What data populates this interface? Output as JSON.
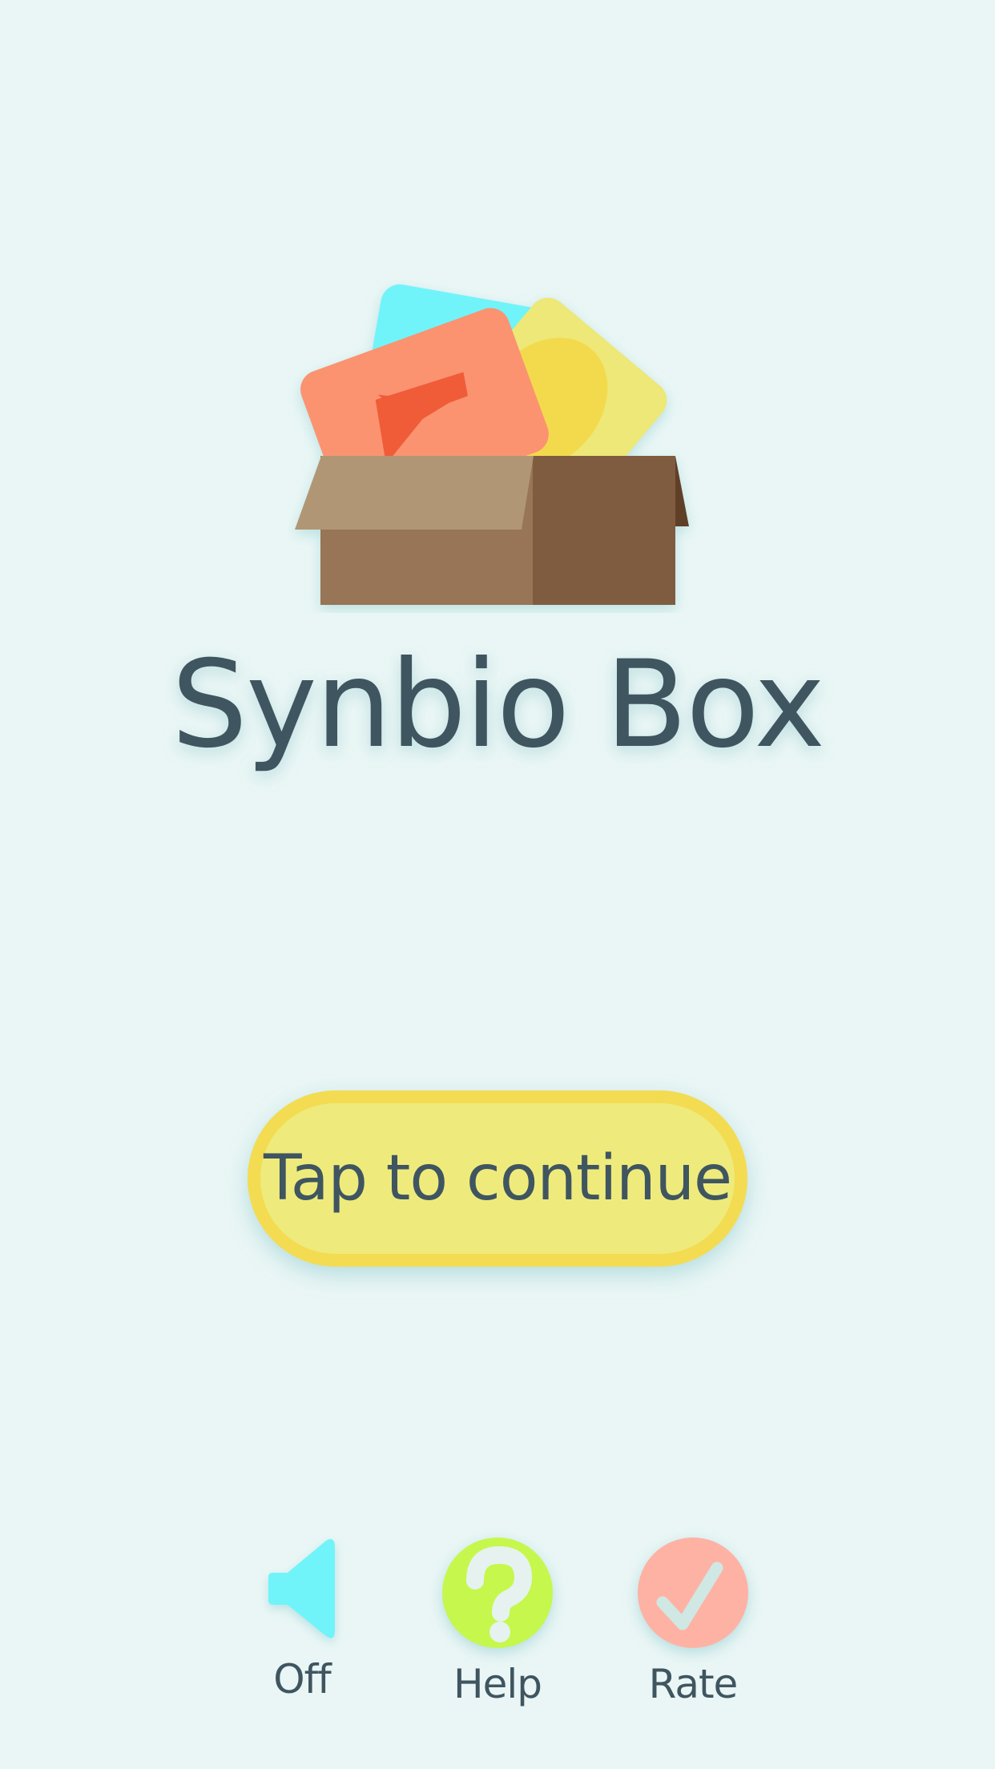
{
  "app": {
    "title": "Synbio Box"
  },
  "main": {
    "continue_label": "Tap to continue"
  },
  "bottom_bar": {
    "sound": {
      "label": "Off",
      "icon": "speaker-icon"
    },
    "help": {
      "label": "Help",
      "icon": "question-mark-icon"
    },
    "rate": {
      "label": "Rate",
      "icon": "checkmark-icon"
    }
  },
  "colors": {
    "background": "#e9f6f5",
    "text": "#3f5560",
    "button_fill": "#eeeb7c",
    "button_border": "#f3dc52",
    "sound_icon": "#6ff4fa",
    "help_circle": "#c6f74d",
    "rate_circle": "#feb2a4"
  }
}
